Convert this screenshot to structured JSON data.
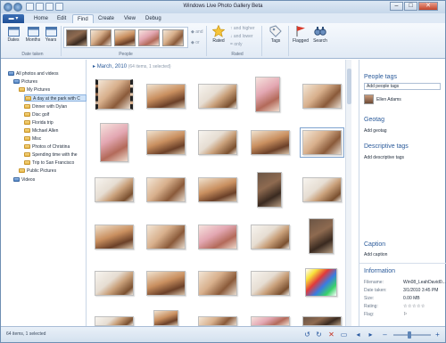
{
  "window": {
    "title": "Windows Live Photo Gallery Beta",
    "controls": {
      "minimize": "–",
      "maximize": "□",
      "close": "✕"
    }
  },
  "tabs": [
    {
      "label": "Home"
    },
    {
      "label": "Edit"
    },
    {
      "label": "Find"
    },
    {
      "label": "Create"
    },
    {
      "label": "View"
    },
    {
      "label": "Debug"
    }
  ],
  "active_tab": "Find",
  "ribbon": {
    "dates_label": "Dates",
    "months_label": "Months",
    "years_label": "Years",
    "date_taken_group": "Date taken",
    "people_group": "People",
    "rated_label": "Rated",
    "and_higher": "and higher",
    "and_lower": "and lower",
    "only": "only",
    "rated_group": "Rated",
    "and_label": "and",
    "or_label": "or",
    "tags_label": "Tags",
    "flagged_label": "Flagged",
    "search_label": "Search"
  },
  "tree": {
    "items": [
      {
        "label": "All photos and videos"
      },
      {
        "label": "Pictures"
      },
      {
        "label": "My Pictures"
      },
      {
        "label": "A day at the park with C"
      },
      {
        "label": "Dinner with Dylan"
      },
      {
        "label": "Disc golf"
      },
      {
        "label": "Florida trip"
      },
      {
        "label": "Michael Allen"
      },
      {
        "label": "Misc"
      },
      {
        "label": "Photos of Christina"
      },
      {
        "label": "Spending time with the"
      },
      {
        "label": "Trip to San Francisco"
      },
      {
        "label": "Public Pictures"
      },
      {
        "label": "Videos"
      }
    ]
  },
  "gallery": {
    "heading": "March, 2010",
    "count": "(64 items, 1 selected)"
  },
  "pane": {
    "people_tags": "People tags",
    "add_people_tags": "Add people tags",
    "person": "Ellen Adams",
    "geotag": "Geotag",
    "add_geotag": "Add geotag",
    "descriptive_tags": "Descriptive tags",
    "add_descriptive_tags": "Add descriptive tags",
    "caption": "Caption",
    "add_caption": "Add caption",
    "information": "Information",
    "filename_label": "Filename:",
    "filename": "Win08_LeahDavid0...",
    "date_taken_label": "Date taken:",
    "date_taken": "3/1/2010  3:45 PM",
    "size_label": "Size:",
    "size": "0.00 MB",
    "rating_label": "Rating:",
    "rating": "☆☆☆☆☆",
    "flag_label": "Flag:",
    "flag": "⚐"
  },
  "status": {
    "text": "64 items, 1 selected"
  }
}
